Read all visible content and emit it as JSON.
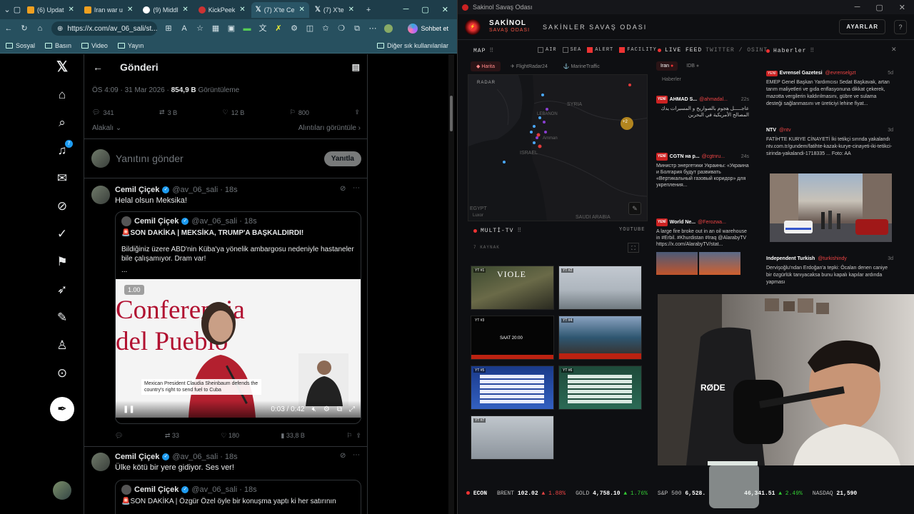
{
  "browser": {
    "tabs": [
      {
        "label": "(6) Updat",
        "color": "#f0a020"
      },
      {
        "label": "Iran war u",
        "color": "#f0a020"
      },
      {
        "label": "(9) Middl",
        "color": "#fff"
      },
      {
        "label": "KickPeek",
        "color": "#c33"
      },
      {
        "label": "(7) X'te Ce",
        "color": "#fff",
        "active": true
      },
      {
        "label": "(7) X'te",
        "color": "#fff"
      }
    ],
    "url": "https://x.com/av_06_sali/st...",
    "chat_label": "Sohbet et",
    "bookmarks": [
      "Sosyal",
      "Basın",
      "Video",
      "Yayın"
    ],
    "other_bookmarks": "Diğer sık kullanılanlar"
  },
  "x": {
    "header_title": "Gönderi",
    "meta_time": "ÖS 4:09 · 31 Mar 2026 · ",
    "meta_views": "854,9 B",
    "meta_views_label": "Görüntüleme",
    "stats": {
      "replies": "341",
      "reposts": "3 B",
      "likes": "12 B",
      "bookmarks": "800"
    },
    "relevance": "Alakalı",
    "quotes_link": "Alıntıları görüntüle",
    "reply_placeholder": "Yanıtını gönder",
    "reply_button": "Yanıtla",
    "post1": {
      "name": "Cemil Çiçek",
      "handle": "@av_06_sali · 18s",
      "text": "Helal olsun Meksika!",
      "quote_name": "Cemil Çiçek",
      "quote_handle": "@av_06_sali · 18s",
      "quote_text1": "🚨SON DAKİKA | MEKSİKA, TRUMP'A BAŞKALDIRDI!",
      "quote_text2": "Bildiğiniz üzere ABD'nin Küba'ya yönelik ambargosu nedeniyle hastaneler bile çalışamıyor. Dram var!",
      "quote_text3": "...",
      "video_speed": "1.00",
      "video_bg_text1": "Conferencia",
      "video_bg_text2": "del Pueblo",
      "video_caption": "Mexican President Claudia Sheinbaum defends the country's right to send fuel to Cuba",
      "video_time": "0:03 / 0:42",
      "reposts": "33",
      "likes": "180",
      "views": "33,8 B"
    },
    "post2": {
      "name": "Cemil Çiçek",
      "handle": "@av_06_sali · 18s",
      "text": "Ülke kötü bir yere gidiyor. Ses ver!",
      "quote_name": "Cemil Çiçek",
      "quote_handle": "@av_06_sali · 18s",
      "quote_text1": "🚨SON DAKİKA | Özgür Özel öyle bir konuşma yaptı ki her satırının"
    }
  },
  "app": {
    "window_title": "Sakinol Savaş Odası",
    "brand": "SAKİNOL",
    "brand_sub": "SAVAŞ ODASI",
    "room_name": "SAKİNLER SAVAŞ ODASI",
    "settings": "AYARLAR",
    "help": "?",
    "map_title": "MAP",
    "filters": [
      {
        "label": "AIR",
        "on": false
      },
      {
        "label": "SEA",
        "on": false
      },
      {
        "label": "ALERT",
        "on": true
      },
      {
        "label": "FACILITY",
        "on": true
      }
    ],
    "map_tabs": [
      "Harita",
      "FlightRadar24",
      "MarineTraffic"
    ],
    "map_labels": {
      "radar": "RADAR",
      "syria": "SYRIA",
      "lebanon": "LEBANON",
      "israel": "ISRAEL",
      "amman": "Amman",
      "saudi": "SAUDI ARABIA",
      "egypt": "EGYPT",
      "luxor": "Luxor",
      "cluster": "+2"
    },
    "live_feed_title": "LIVE FEED",
    "live_feed_sub": "TWITTER / OSINT",
    "feed_tabs": [
      "Iran",
      "IDB"
    ],
    "feed_filter": "Haberler",
    "feed": [
      {
        "name": "AHMAD S...",
        "handle": "@ahmadal...",
        "age": "22s",
        "text": "عاجـــــل هجوم بالصواريخ و المسيرات يدك المصالح الأمريكية في البحرين"
      },
      {
        "name": "CGTN на р...",
        "handle": "@cgtnru...",
        "age": "24s",
        "text": "Министр энергетики Украины: «Украина и Болгария будут развивать «Вертикальный газовый коридор» для укрепления..."
      },
      {
        "name": "World Ne...",
        "handle": "@Ferozwa...",
        "age": "",
        "text": "A large fire broke out in an oil warehouse in #Erbil. #Khurdistan #Iraq @AlarabyTV https://x.com/AlarabyTV/stat..."
      }
    ],
    "news_title": "Haberler",
    "news": [
      {
        "source": "Evrensel Gazetesi",
        "handle": "@evrenselgzt",
        "age": "5d",
        "text": "EMEP Genel Başkan Yardımcısı Sedat Başkavak, artan tarım maliyetleri ve gıda enflasyonuna dikkat çekerek, mazotta vergilerin kaldırılmasını, gübre ve sulama desteği sağlanmasını ve üreticiyi lehine fiyat..."
      },
      {
        "source": "NTV",
        "handle": "@ntv",
        "age": "3d",
        "text": "FATİH'TE KURYE CİNAYETİ İki tetikçi sırında yakalandı ntv.com.tr/gundem/fatihte-kazak-kurye-cinayeti-iki-tetikci-sirinda-yakalandi-1718335 ... Foto: AA"
      },
      {
        "source": "Independent Turkish",
        "handle": "@turkishindy",
        "age": "3d",
        "text": "Dervişoğlu'ndan Erdoğan'a tepki: Öcalan denen caniye bir özgürlük tanıyacaksa bunu kapalı kapılar ardında yapması"
      }
    ],
    "multitv_title": "MULTİ-TV",
    "multitv_source": "YOUTUBE",
    "multitv_count": "7 KAYNAK",
    "tv_labels": [
      "YT #1",
      "YT #2",
      "YT #3",
      "YT #4",
      "YT #5",
      "YT #6",
      "YT #7"
    ],
    "tv1_text": "VIOLE",
    "tv3_text": "SAAT 20:00",
    "cam_brand": "RØDE",
    "ticker": {
      "econ": "ECON",
      "brent_label": "BRENT",
      "brent": "102.02",
      "brent_chg": "▲ 1.88%",
      "gold_label": "GOLD",
      "gold": "4,758.10",
      "gold_chg": "▲ 1.76%",
      "sp_label": "S&P 500",
      "sp": "6,528.",
      "other": "46,341.51",
      "other_chg": "▲ 2.49%",
      "nasdaq_label": "NASDAQ",
      "nasdaq": "21,590"
    },
    "colors": {
      "accent": "#e33333",
      "bg": "#0e0f12",
      "x_blue": "#1d9bf0"
    }
  }
}
